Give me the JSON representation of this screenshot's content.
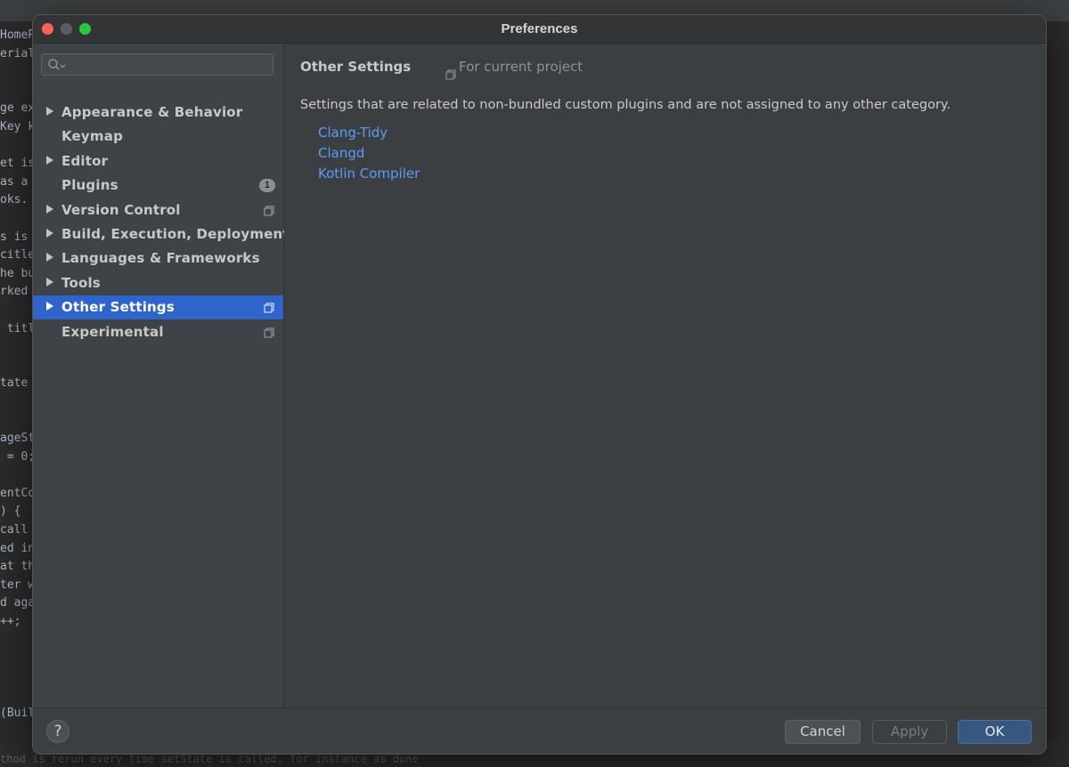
{
  "background_editor": {
    "lines": [
      "HomeP",
      "erial",
      "",
      "",
      "ge ex",
      "Key k",
      "",
      "et is",
      "as a",
      "oks.",
      "",
      "s is",
      "citle",
      "he bu",
      "rked",
      "",
      " titl",
      "",
      "",
      "tate",
      "",
      "",
      "ageSt",
      " = 0;",
      "",
      "entCo",
      ") {",
      "call",
      "ed in",
      "at th",
      "ter w",
      "d aga",
      "++;",
      "",
      "",
      "",
      "",
      "(Buil"
    ],
    "bottom_line": "thod is rerun every time setState is called, for instance as done"
  },
  "dialog": {
    "title": "Preferences"
  },
  "sidebar": {
    "search_placeholder": "",
    "items": [
      {
        "label": "Appearance & Behavior",
        "expandable": true,
        "selected": false,
        "badge": "",
        "project_scope": false
      },
      {
        "label": "Keymap",
        "expandable": false,
        "selected": false,
        "badge": "",
        "project_scope": false
      },
      {
        "label": "Editor",
        "expandable": true,
        "selected": false,
        "badge": "",
        "project_scope": false
      },
      {
        "label": "Plugins",
        "expandable": false,
        "selected": false,
        "badge": "1",
        "project_scope": false
      },
      {
        "label": "Version Control",
        "expandable": true,
        "selected": false,
        "badge": "",
        "project_scope": true
      },
      {
        "label": "Build, Execution, Deployment",
        "expandable": true,
        "selected": false,
        "badge": "",
        "project_scope": false
      },
      {
        "label": "Languages & Frameworks",
        "expandable": true,
        "selected": false,
        "badge": "",
        "project_scope": false
      },
      {
        "label": "Tools",
        "expandable": true,
        "selected": false,
        "badge": "",
        "project_scope": false
      },
      {
        "label": "Other Settings",
        "expandable": true,
        "selected": true,
        "badge": "",
        "project_scope": true
      },
      {
        "label": "Experimental",
        "expandable": false,
        "selected": false,
        "badge": "",
        "project_scope": true
      }
    ]
  },
  "content": {
    "heading": "Other Settings",
    "scope_label": "For current project",
    "description": "Settings that are related to non-bundled custom plugins and are not assigned to any other category.",
    "links": [
      "Clang-Tidy",
      "Clangd",
      "Kotlin Compiler"
    ]
  },
  "footer": {
    "help_label": "?",
    "cancel_label": "Cancel",
    "apply_label": "Apply",
    "ok_label": "OK"
  },
  "colors": {
    "selection": "#2f65ca",
    "link": "#589df6",
    "ok_button": "#365880"
  }
}
